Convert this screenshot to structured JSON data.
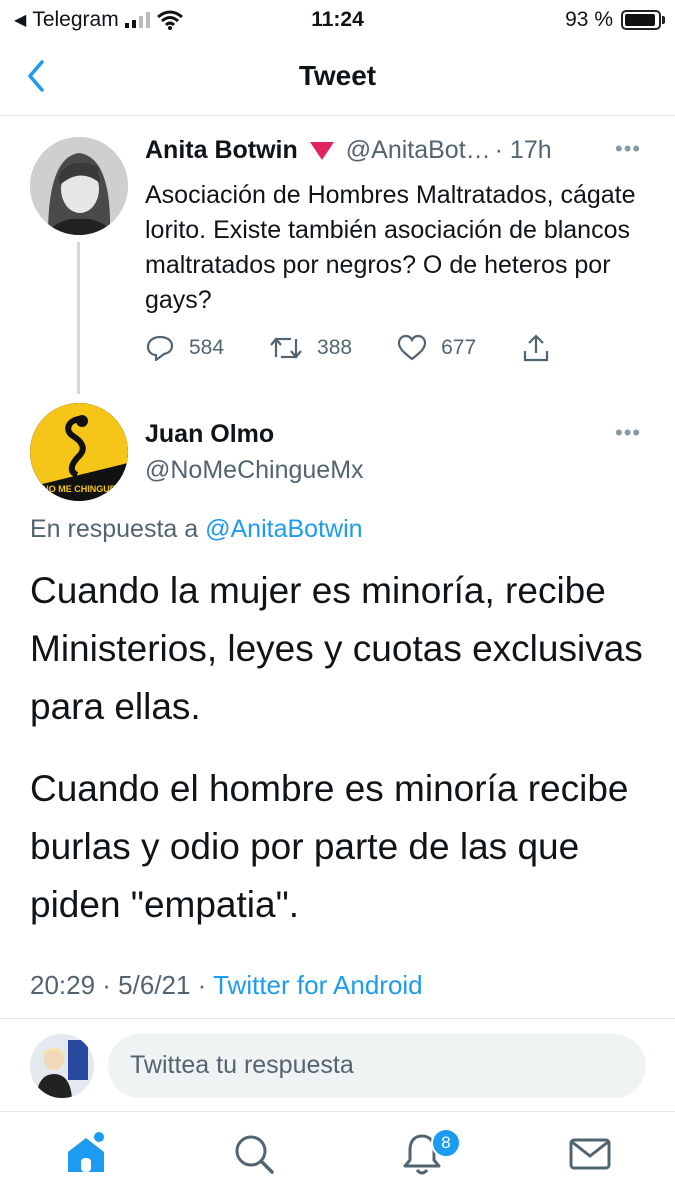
{
  "status_bar": {
    "carrier": "Telegram",
    "time": "11:24",
    "battery": "93 %",
    "battery_level": 0.93
  },
  "header": {
    "title": "Tweet"
  },
  "parent_tweet": {
    "name": "Anita Botwin",
    "handle": "@AnitaBot…",
    "age": "· 17h",
    "text": "Asociación de Hombres Maltratados, cágate lorito. Existe también asociación de blancos maltratados por negros? O de heteros por gays?",
    "replies": "584",
    "retweets": "388",
    "likes": "677"
  },
  "main_tweet": {
    "name": "Juan Olmo",
    "handle": "@NoMeChingueMx",
    "avatar_text": "NO ME CHINGUE",
    "reply_prefix": "En respuesta a",
    "reply_to": "@AnitaBotwin",
    "paragraphs": [
      "Cuando la mujer es minoría, recibe Ministerios, leyes y cuotas exclusivas para ellas.",
      "Cuando el hombre es minoría recibe burlas y odio por parte de las que piden \"empatia\"."
    ],
    "timestamp": "20:29 · 5/6/21 ·",
    "client": "Twitter for Android"
  },
  "composer": {
    "placeholder": "Twittea tu respuesta"
  },
  "tabbar": {
    "notifications_badge": "8"
  },
  "colors": {
    "accent": "#1d9bf0",
    "text": "#0f1419",
    "muted": "#536471",
    "verified_triangle": "#e0245e"
  }
}
